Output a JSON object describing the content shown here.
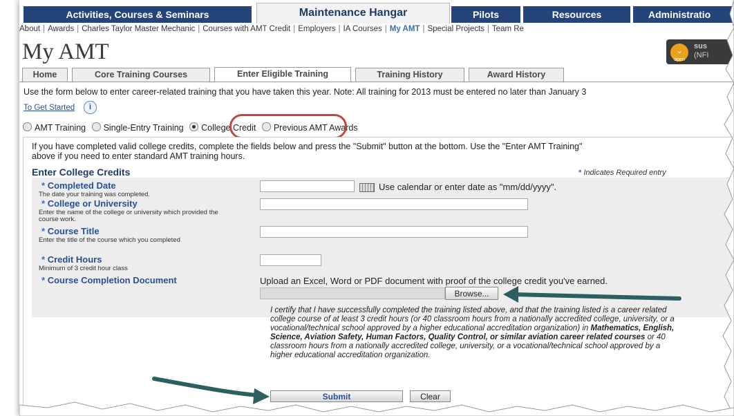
{
  "top_nav": {
    "tabs": [
      {
        "label": "Activities, Courses & Seminars"
      },
      {
        "label": "Maintenance Hangar"
      },
      {
        "label": "Pilots"
      },
      {
        "label": "Resources"
      },
      {
        "label": "Administratio"
      }
    ],
    "active": "Maintenance Hangar"
  },
  "sub_links": [
    "About",
    "Awards",
    "Charles Taylor Master Mechanic",
    "Courses with AMT Credit",
    "Employers",
    "IA Courses",
    "My AMT",
    "Special Projects",
    "Team Re"
  ],
  "current_sub_link": "My AMT",
  "page_title": "My AMT",
  "user": {
    "badge": "open",
    "name_line1": "sus",
    "name_line2": "(NFI"
  },
  "tabs": [
    {
      "label": "Home"
    },
    {
      "label": "Core Training Courses"
    },
    {
      "label": "Enter Eligible Training"
    },
    {
      "label": "Training History"
    },
    {
      "label": "Award History"
    }
  ],
  "active_tab": "Enter Eligible Training",
  "intro": "Use the form below to enter career-related training that you have taken this year. Note: All training for 2013 must be entered no later than January 3",
  "get_started": "To Get Started",
  "training_types": [
    {
      "label": "AMT Training",
      "selected": false
    },
    {
      "label": "Single-Entry Training",
      "selected": false
    },
    {
      "label": "College Credit",
      "selected": true
    },
    {
      "label": "Previous AMT Awards",
      "selected": false
    }
  ],
  "panel_intro_line1": "If you have completed valid college credits, complete the fields below and press the \"Submit\" button at the bottom. Use the \"Enter AMT Training\"",
  "panel_intro_line2": "above if you need to enter standard AMT training hours.",
  "section_title": "Enter College Credits",
  "required_note": "Indicates Required entry",
  "fields": {
    "completed_date": {
      "label": "Completed Date",
      "desc": "The date your training was completed.",
      "value": "",
      "hint": "Use calendar or enter date as \"mm/dd/yyyy\"."
    },
    "college": {
      "label": "College or University",
      "desc": "Enter the name of the college or university which provided the course work.",
      "value": ""
    },
    "course_title": {
      "label": "Course Title",
      "desc": "Enter the title of the course which you completed",
      "value": ""
    },
    "credit_hours": {
      "label": "Credit Hours",
      "desc": "Minimum of 3 credit hour class",
      "value": ""
    },
    "document": {
      "label": "Course Completion Document",
      "hint": "Upload an Excel, Word or PDF document with proof of the college credit you've earned.",
      "browse_label": "Browse..."
    }
  },
  "certification": {
    "part1": "I certify that I have successfully completed the training listed above, and that the training listed is a career related college course of at least 3 credit hours (or 40 classroom hours from a nationally accredited college, university, or a vocational/technical school approved by a higher educational accreditation organization) in ",
    "bold": "Mathematics, English, Science, Aviation Safety, Human Factors, Quality Control, or similar aviation career related courses",
    "part2": " or 40 classroom hours from a nationally accredited college, university, or a vocational/technical school approved by a higher educational accreditation organization."
  },
  "buttons": {
    "submit": "Submit",
    "clear": "Clear"
  },
  "colors": {
    "nav_blue": "#25457a",
    "link_blue": "#2a4f9a",
    "highlight_red": "#c0473a",
    "arrow_teal": "#2d5f62"
  }
}
